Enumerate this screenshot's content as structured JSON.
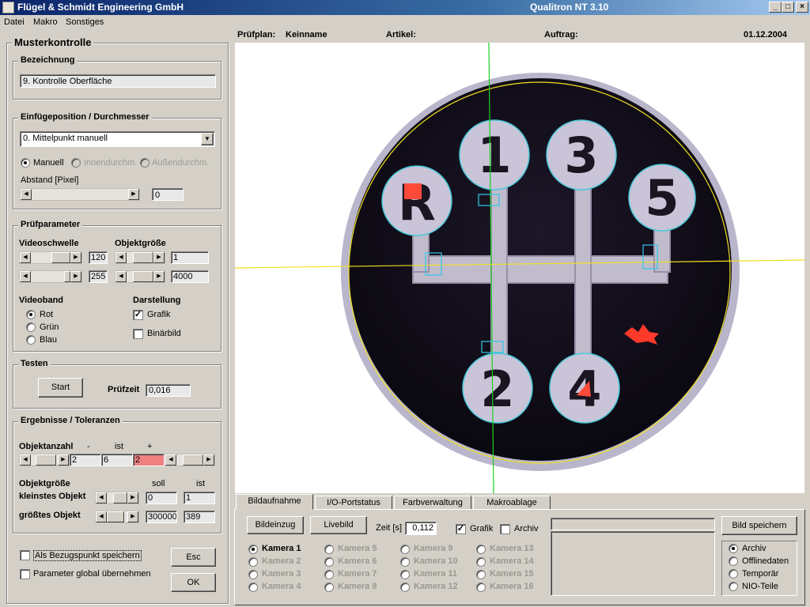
{
  "window": {
    "title": "Flügel & Schmidt  Engineering GmbH",
    "app_name": "Qualitron NT  3.10",
    "min": "_",
    "max": "□",
    "close": "×"
  },
  "menu": [
    "Datei",
    "Makro",
    "Sonstiges"
  ],
  "panel": {
    "title": "Musterkontrolle",
    "bezeichnung": {
      "title": "Bezeichnung",
      "value": "9.  Kontrolle Oberfläche"
    },
    "einfuege": {
      "title": "Einfügeposition / Durchmesser",
      "select_value": "0. Mittelpunkt manuell",
      "radios": [
        {
          "label": "Manuell",
          "checked": true,
          "enabled": true
        },
        {
          "label": "Innendurchm.",
          "checked": false,
          "enabled": false
        },
        {
          "label": "Außendurchm.",
          "checked": false,
          "enabled": false
        }
      ],
      "abstand_label": "Abstand [Pixel]",
      "abstand_value": "0"
    },
    "pruefparameter": {
      "title": "Prüfparameter",
      "videoschwelle_label": "Videoschwelle",
      "videoschwelle_values": [
        "120",
        "255"
      ],
      "objektgroesse_label": "Objektgröße",
      "objektgroesse_values": [
        "1",
        "4000"
      ],
      "videoband_label": "Videoband",
      "videoband_options": [
        {
          "label": "Rot",
          "checked": true
        },
        {
          "label": "Grün",
          "checked": false
        },
        {
          "label": "Blau",
          "checked": false
        }
      ],
      "darstellung_label": "Darstellung",
      "darstellung_options": [
        {
          "label": "Grafik",
          "checked": true
        },
        {
          "label": "Binärbild",
          "checked": false
        }
      ]
    },
    "testen": {
      "title": "Testen",
      "start_label": "Start",
      "pruefzeit_label": "Prüfzeit",
      "pruefzeit_value": "0,016"
    },
    "ergebnisse": {
      "title": "Ergebnisse / Toleranzen",
      "objektanzahl_label": "Objektanzahl",
      "col_minus": "-",
      "col_ist": "ist",
      "col_plus": "+",
      "anzahl_minus": "2",
      "anzahl_ist": "6",
      "anzahl_plus": "2",
      "objektgroesse_label": "Objektgröße",
      "col_soll": "soll",
      "col_ist2": "ist",
      "kleinstes_label": "kleinstes Objekt",
      "kleinstes_soll": "0",
      "kleinstes_ist": "1",
      "groesstes_label": "größtes Objekt",
      "groesstes_soll": "300000",
      "groesstes_ist": "389"
    },
    "als_bezugspunkt": "Als Bezugspunkt speichern",
    "parameter_global": "Parameter global übernehmen",
    "esc_label": "Esc",
    "ok_label": "OK"
  },
  "header": {
    "pruefplan_label": "Prüfplan:",
    "pruefplan_value": "Keinname",
    "artikel_label": "Artikel:",
    "auftrag_label": "Auftrag:",
    "date": "01.12.2004"
  },
  "image": {
    "knob_numbers": [
      "1",
      "3",
      "5",
      "R",
      "2",
      "4"
    ]
  },
  "tabs": [
    "Bildaufnahme",
    "I/O-Portstatus",
    "Farbverwaltung",
    "Makroablage"
  ],
  "bottom": {
    "bildeinzug": "Bildeinzug",
    "livebild": "Livebild",
    "zeit_label": "Zeit [s]",
    "zeit_value": "0,112",
    "grafik_label": "Grafik",
    "archiv_label": "Archiv",
    "bild_speichern": "Bild speichern",
    "cameras": [
      "Kamera 1",
      "Kamera 2",
      "Kamera 3",
      "Kamera 4",
      "Kamera 5",
      "Kamera 6",
      "Kamera 7",
      "Kamera 8",
      "Kamera 9",
      "Kamera 10",
      "Kamera 11",
      "Kamera 12",
      "Kamera 13",
      "Kamera 14",
      "Kamera 15",
      "Kamera 16"
    ],
    "storage_options": [
      "Archiv",
      "Offlinedaten",
      "Temporär",
      "NIO-Teile"
    ]
  }
}
